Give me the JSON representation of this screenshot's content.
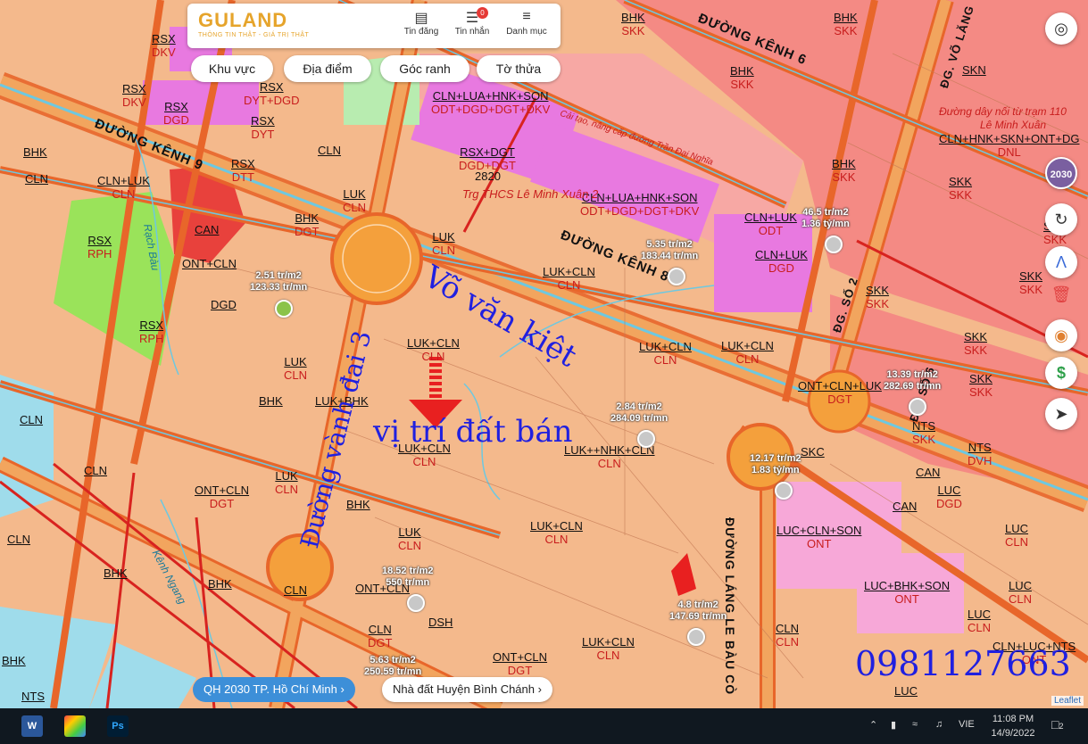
{
  "header": {
    "logo_text": "GULAND",
    "logo_tagline": "THÔNG TIN THẬT - GIÁ TRỊ THẬT",
    "nav": [
      {
        "label": "Tin đăng",
        "icon": "news-icon"
      },
      {
        "label": "Tin nhắn",
        "icon": "message-icon",
        "badge": "0"
      },
      {
        "label": "Danh mục",
        "icon": "menu-icon"
      }
    ]
  },
  "filters": [
    "Khu vực",
    "Địa điểm",
    "Góc ranh",
    "Tờ thửa"
  ],
  "right_controls": {
    "year_label": "2030",
    "buttons": [
      "locate-icon",
      "year-2030-icon",
      "refresh-icon",
      "measure-icon",
      "delete-icon",
      "palette-icon",
      "price-icon",
      "share-icon"
    ]
  },
  "roads": {
    "kenh9": "ĐƯỜNG KÊNH 9",
    "kenh8": "ĐƯỜNG KÊNH 8",
    "kenh6": "ĐƯỜNG KÊNH 6",
    "so2": "ĐG. SỐ 2",
    "so6": "ĐG. SỐ 6",
    "lang_le": "ĐƯỜNG LÁNG LE BÀU CÒ",
    "vo_lang": "ĐG. VÕ LĂNG"
  },
  "zones": [
    {
      "t": "RSX",
      "b": "DKV"
    },
    {
      "t": "RSX",
      "b": "DKV"
    },
    {
      "t": "RSX",
      "b": "DGD"
    },
    {
      "t": "RSX",
      "b": "DYT"
    },
    {
      "t": "RSX",
      "b": "DYT+DGD"
    },
    {
      "t": "RSX",
      "b": "DTT"
    },
    {
      "t": "BHK",
      "b": ""
    },
    {
      "t": "CLN",
      "b": ""
    },
    {
      "t": "CLN+LUK",
      "b": "CLN"
    },
    {
      "t": "RSX",
      "b": "RPH"
    },
    {
      "t": "CAN",
      "b": ""
    },
    {
      "t": "ONT+CLN",
      "b": ""
    },
    {
      "t": "RSX",
      "b": "RPH"
    },
    {
      "t": "DGD",
      "b": ""
    },
    {
      "t": "CLN",
      "b": ""
    },
    {
      "t": "LUK",
      "b": "CLN"
    },
    {
      "t": "BHK",
      "b": "DGT"
    },
    {
      "t": "LUK",
      "b": "CLN"
    },
    {
      "t": "BHK",
      "b": ""
    },
    {
      "t": "LUK+BHK",
      "b": ""
    },
    {
      "t": "LUK+CLN",
      "b": "CLN"
    },
    {
      "t": "LUK",
      "b": "CLN"
    },
    {
      "t": "LUK+CLN",
      "b": "CLN"
    },
    {
      "t": "LUK+CLN",
      "b": "CLN"
    },
    {
      "t": "LUK+CLN",
      "b": "CLN"
    },
    {
      "t": "LUK++NHK+CLN",
      "b": "CLN"
    },
    {
      "t": "LUK+CLN",
      "b": "CLN"
    },
    {
      "t": "CLN+LUA+HNK+SON",
      "b": "ODT+DGD+DGT+DKV"
    },
    {
      "t": "RSX+DGT",
      "b": "DGD+DGT"
    },
    {
      "t": "CLN+LUA+HNK+SON",
      "b": "ODT+DGD+DGT+DKV"
    },
    {
      "t": "CLN+LUK",
      "b": "ODT"
    },
    {
      "t": "CLN+LUK",
      "b": "DGD"
    },
    {
      "t": "BHK",
      "b": "SKK"
    },
    {
      "t": "BHK",
      "b": "SKK"
    },
    {
      "t": "BHK",
      "b": "SKK"
    },
    {
      "t": "BHK",
      "b": "SKK"
    },
    {
      "t": "SKN",
      "b": ""
    },
    {
      "t": "SKK",
      "b": "SKK"
    },
    {
      "t": "SKK",
      "b": "SKK"
    },
    {
      "t": "SKK",
      "b": "SKK"
    },
    {
      "t": "SKK",
      "b": "SKK"
    },
    {
      "t": "SKK",
      "b": "SKK"
    },
    {
      "t": "SKK",
      "b": "SKK"
    },
    {
      "t": "ONT+CLN+LUK",
      "b": "DGT"
    },
    {
      "t": "NTS",
      "b": "DVH"
    },
    {
      "t": "CAN",
      "b": ""
    },
    {
      "t": "LUC",
      "b": "DGD"
    },
    {
      "t": "CAN",
      "b": ""
    },
    {
      "t": "LUC+CLN+SON",
      "b": "ONT"
    },
    {
      "t": "LUC",
      "b": "CLN"
    },
    {
      "t": "LUC+BHK+SON",
      "b": "ONT"
    },
    {
      "t": "LUC",
      "b": "CLN"
    },
    {
      "t": "LUC",
      "b": "CLN"
    },
    {
      "t": "CLN+LUC+NTS",
      "b": "ONT"
    },
    {
      "t": "LUC",
      "b": "CLN"
    },
    {
      "t": "CLN",
      "b": "CLN"
    },
    {
      "t": "ONT+CLN",
      "b": "DGT"
    },
    {
      "t": "BHK",
      "b": ""
    },
    {
      "t": "LUK",
      "b": "CLN"
    },
    {
      "t": "CLN",
      "b": ""
    },
    {
      "t": "BHK",
      "b": ""
    },
    {
      "t": "BHK",
      "b": ""
    },
    {
      "t": "CLN",
      "b": ""
    },
    {
      "t": "ONT+CLN",
      "b": ""
    },
    {
      "t": "LUK",
      "b": "CLN"
    },
    {
      "t": "LUK+CLN",
      "b": "CLN"
    },
    {
      "t": "ONT+CLN",
      "b": "DGT"
    },
    {
      "t": "LUK+CLN",
      "b": "CLN"
    },
    {
      "t": "CLN",
      "b": "DGT"
    },
    {
      "t": "DSH",
      "b": ""
    },
    {
      "t": "NTS",
      "b": ""
    },
    {
      "t": "NTS",
      "b": "SKK"
    },
    {
      "t": "SKC",
      "b": ""
    },
    {
      "t": "CLN+HNK+SKN+ONT+DG",
      "b": "DNL"
    },
    {
      "t": "SKK",
      "b": "SKK"
    },
    {
      "t": "BHK",
      "b": ""
    },
    {
      "t": "CLN",
      "b": ""
    }
  ],
  "prices": [
    {
      "a": "2.51 tr/m2",
      "b": "123.33 tr/mn"
    },
    {
      "a": "5.35 tr/m2",
      "b": "183.44 tr/mn"
    },
    {
      "a": "46.5 tr/m2",
      "b": "1.36 tỷ/mn"
    },
    {
      "a": "13.39 tr/m2",
      "b": "282.69 tr/mn"
    },
    {
      "a": "2.84 tr/m2",
      "b": "284.09 tr/mn"
    },
    {
      "a": "12.17 tr/m2",
      "b": "1.83 tỷ/mn"
    },
    {
      "a": "18.52 tr/m2",
      "b": "550 tr/mn"
    },
    {
      "a": "4.8 tr/m2",
      "b": "147.69 tr/mn"
    },
    {
      "a": "5.63 tr/m2",
      "b": "250.59 tr/mn"
    }
  ],
  "annotations": {
    "street_name": "Võ văn kiệt",
    "ring_road": "Đường vành đai 3",
    "land_for_sale": "vị trí đất bán",
    "phone": "0981127663",
    "school": "Trg THCS Lê Minh Xuân 2",
    "school_code": "2820",
    "canal_rach": "Rạch Bàu",
    "canal_kenh": "Kênh Ngang",
    "powerline": "Đường dây nối từ trạm 110",
    "powerline2": "Lê Minh Xuân",
    "bridge_note": "Cải tạo, nâng cấp đường Trần Đại Nghĩa"
  },
  "bottom": {
    "plan_link": "QH 2030 TP. Hồ Chí Minh",
    "area_link": "Nhà đất Huyện Bình Chánh",
    "leaflet": "Leaflet"
  },
  "taskbar": {
    "lang": "VIE",
    "time": "11:08 PM",
    "date": "14/9/2022",
    "notifications": "2"
  },
  "colors": {
    "agri": "#f4b98c",
    "urban": "#f7a8a4",
    "industrial": "#f48a84",
    "public": "#e879e0",
    "forest": "#9ae35a",
    "security": "#e8413c",
    "road": "#e8662a",
    "road_fill": "#f2a55e",
    "water": "#9fdceb",
    "handwriting": "#2020e0"
  }
}
